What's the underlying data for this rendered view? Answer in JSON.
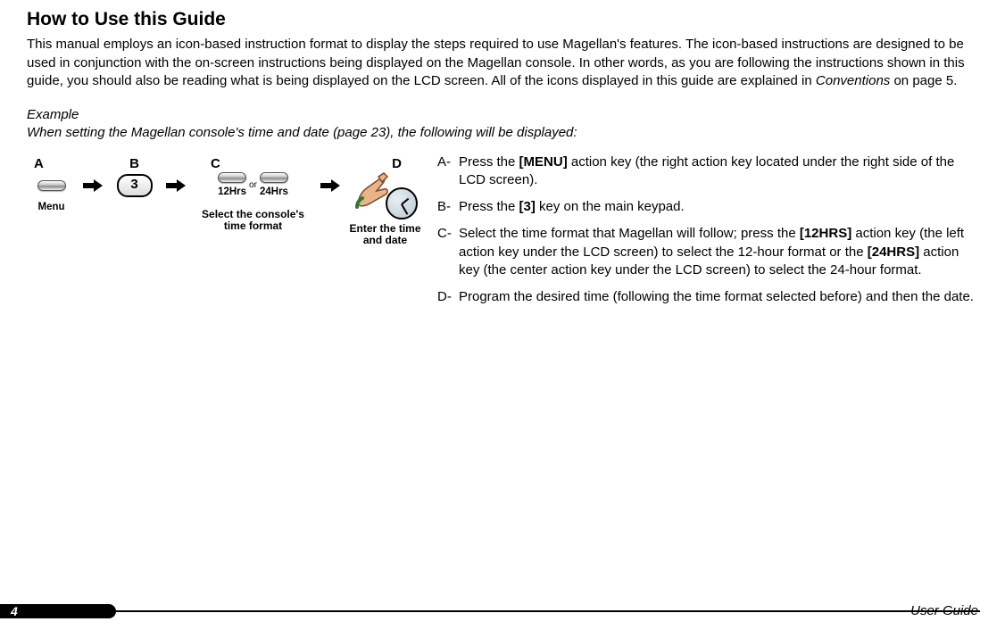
{
  "heading": "How to Use this Guide",
  "intro": {
    "p1": "This manual employs an icon-based instruction format to display the steps required to use Magellan's features. The icon-based instructions are designed to be used in conjunction with the on-screen instructions being displayed on the Magellan console. In other words, as you are following the instructions shown in this guide, you should also be reading what is being displayed on the LCD screen. All of the icons displayed in this guide are explained in ",
    "conventions": "Conventions",
    "p2": " on page 5."
  },
  "example_label": "Example",
  "example_line": "When setting the Magellan console's time and date (page 23), the following will be displayed:",
  "flow": {
    "a": {
      "letter": "A",
      "label": "Menu"
    },
    "b": {
      "letter": "B",
      "key": "3"
    },
    "c": {
      "letter": "C",
      "left": "12Hrs",
      "right": "24Hrs",
      "or": "or",
      "caption": "Select the console's time format"
    },
    "d": {
      "letter": "D",
      "caption": "Enter the time and date"
    }
  },
  "instructions": {
    "a": {
      "key": "A-",
      "pre": "Press the ",
      "b1a": "[",
      "b1b": "MENU",
      "b1c": "]",
      "post": " action key (the right action key located under the right side of the LCD screen)."
    },
    "b": {
      "key": "B-",
      "pre": "Press the ",
      "b1": "[3]",
      "post": " key on the main keypad."
    },
    "c": {
      "key": "C-",
      "t1": "Select the time format that Magellan will follow; press the ",
      "b1a": "[12",
      "b1b": "HRS",
      "b1c": "]",
      "t2": " action key (the left action key under the LCD screen) to select the 12-hour format or the ",
      "b2a": "[24",
      "b2b": "HRS",
      "b2c": "]",
      "t3": " action key (the center action key under the LCD screen) to select the 24-hour format."
    },
    "d": {
      "key": "D-",
      "text": "Program the desired time (following the time format selected before) and then the date."
    }
  },
  "footer": {
    "page": "4",
    "label": "User Guide"
  }
}
